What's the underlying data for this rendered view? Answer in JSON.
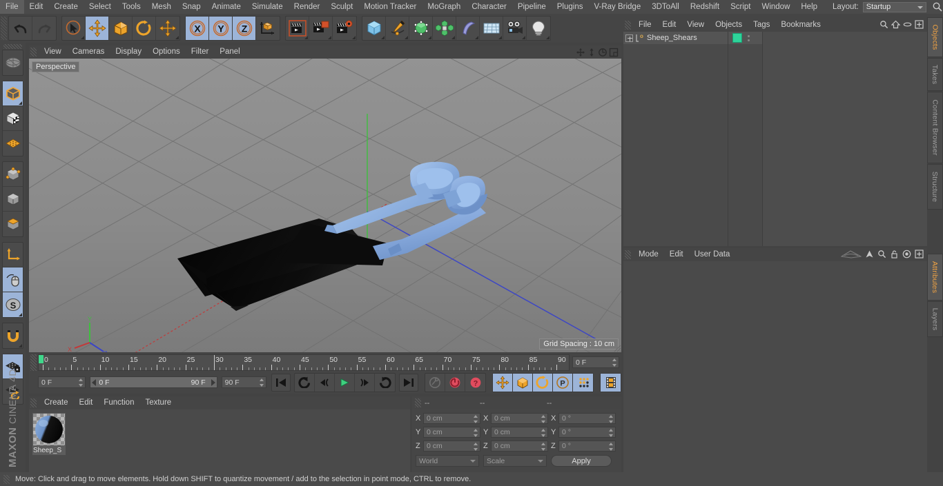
{
  "menubar": {
    "items": [
      "File",
      "Edit",
      "Create",
      "Select",
      "Tools",
      "Mesh",
      "Snap",
      "Animate",
      "Simulate",
      "Render",
      "Sculpt",
      "Motion Tracker",
      "MoGraph",
      "Character",
      "Pipeline",
      "Plugins",
      "V-Ray Bridge",
      "3DToAll",
      "Redshift",
      "Script",
      "Window",
      "Help"
    ],
    "layout_label": "Layout:",
    "layout_value": "Startup",
    "search_icon": "search-icon"
  },
  "toolbar": {
    "groups": [
      {
        "name": "history",
        "buttons": [
          {
            "name": "undo-button",
            "icon": "undo-arrow-icon",
            "active": false,
            "has_corner": false
          },
          {
            "name": "redo-button",
            "icon": "redo-arrow-icon",
            "active": false,
            "has_corner": false
          }
        ]
      },
      {
        "name": "transform-tools",
        "buttons": [
          {
            "name": "live-selection-tool",
            "icon": "cursor-circle-icon",
            "active": false,
            "has_corner": true
          },
          {
            "name": "move-tool",
            "icon": "move-arrows-icon",
            "active": true,
            "has_corner": false
          },
          {
            "name": "scale-tool",
            "icon": "scale-box-icon",
            "active": false,
            "has_corner": false
          },
          {
            "name": "rotate-tool",
            "icon": "rotate-arc-icon",
            "active": false,
            "has_corner": false
          },
          {
            "name": "transform-tool",
            "icon": "move-arrows-icon",
            "active": false,
            "has_corner": true
          }
        ]
      },
      {
        "name": "axis-locks",
        "buttons": [
          {
            "name": "x-axis-lock",
            "icon": "x-axis-icon",
            "active": true,
            "has_corner": false
          },
          {
            "name": "y-axis-lock",
            "icon": "y-axis-icon",
            "active": true,
            "has_corner": false
          },
          {
            "name": "z-axis-lock",
            "icon": "z-axis-icon",
            "active": true,
            "has_corner": false
          },
          {
            "name": "world-object-coordinate-toggle",
            "icon": "world-axis-cube-icon",
            "active": false,
            "has_corner": false
          }
        ]
      },
      {
        "name": "render-tools",
        "buttons": [
          {
            "name": "render-view-button",
            "icon": "clapperboard-region-icon",
            "active": false,
            "has_corner": true
          },
          {
            "name": "render-to-picture-viewer-button",
            "icon": "clapperboard-picture-icon",
            "active": false,
            "has_corner": true
          },
          {
            "name": "render-settings-button",
            "icon": "clapperboard-gear-icon",
            "active": false,
            "has_corner": true
          }
        ]
      },
      {
        "name": "create-objects",
        "buttons": [
          {
            "name": "add-primitive-cube-button",
            "icon": "blue-cube-icon",
            "active": false,
            "has_corner": true
          },
          {
            "name": "add-spline-button",
            "icon": "pen-spline-icon",
            "active": false,
            "has_corner": true
          },
          {
            "name": "add-nurbs-generator-button",
            "icon": "green-cube-points-icon",
            "active": false,
            "has_corner": true
          },
          {
            "name": "add-array-button",
            "icon": "green-cluster-icon",
            "active": false,
            "has_corner": true
          },
          {
            "name": "add-deformer-button",
            "icon": "bend-deformer-icon",
            "active": false,
            "has_corner": true
          },
          {
            "name": "add-scene-environment-button",
            "icon": "floor-grid-icon",
            "active": false,
            "has_corner": true
          },
          {
            "name": "add-camera-button",
            "icon": "camera-icon",
            "active": false,
            "has_corner": true
          },
          {
            "name": "add-light-button",
            "icon": "lightbulb-icon",
            "active": false,
            "has_corner": true
          }
        ]
      }
    ]
  },
  "left_toolbar": {
    "groups": [
      {
        "name": "view-group",
        "buttons": [
          {
            "name": "undo-view-button",
            "icon": "globe-wire-icon",
            "active": false,
            "has_corner": false
          }
        ]
      },
      {
        "name": "edit-mode-group",
        "buttons": [
          {
            "name": "make-editable-button",
            "icon": "orange-outline-cube-icon",
            "active": true,
            "has_corner": true
          },
          {
            "name": "enable-axis-modification-button",
            "icon": "checker-cube-icon",
            "active": false,
            "has_corner": false
          },
          {
            "name": "toggle-grid-button",
            "icon": "orange-grid-icon",
            "active": false,
            "has_corner": false
          }
        ]
      },
      {
        "name": "component-mode-group",
        "buttons": [
          {
            "name": "points-mode-button",
            "icon": "cube-points-icon",
            "active": false,
            "has_corner": false
          },
          {
            "name": "edges-mode-button",
            "icon": "cube-edges-icon",
            "active": false,
            "has_corner": false
          },
          {
            "name": "polygons-mode-button",
            "icon": "cube-polygons-icon",
            "active": false,
            "has_corner": false
          }
        ]
      },
      {
        "name": "axis-group",
        "buttons": [
          {
            "name": "object-axis-button",
            "icon": "axis-arrow-icon",
            "active": false,
            "has_corner": false
          },
          {
            "name": "texture-axis-button",
            "icon": "mouse-texture-icon",
            "active": true,
            "has_corner": false
          },
          {
            "name": "workplane-button",
            "icon": "s-disc-icon",
            "active": true,
            "has_corner": true
          }
        ]
      },
      {
        "name": "snap-group",
        "buttons": [
          {
            "name": "enable-snap-button",
            "icon": "magnet-icon",
            "active": false,
            "has_corner": true
          }
        ]
      },
      {
        "name": "workplane-group",
        "buttons": [
          {
            "name": "lock-workplane-button",
            "icon": "grid-lock-icon",
            "active": true,
            "has_corner": false
          },
          {
            "name": "planar-workplane-button",
            "icon": "grid-rotate-icon",
            "active": false,
            "has_corner": false
          }
        ]
      }
    ],
    "brand_primary": "MAXON",
    "brand_secondary": "CINEMA 4D"
  },
  "viewport": {
    "menu_items": [
      "View",
      "Cameras",
      "Display",
      "Options",
      "Filter",
      "Panel"
    ],
    "label": "Perspective",
    "grid_spacing": "Grid Spacing : 10 cm",
    "axis_labels": {
      "x": "X",
      "y": "Y",
      "z": "Z"
    },
    "colors": {
      "x_axis": "#c83232",
      "y_axis": "#3fbe3f",
      "z_axis": "#3c46c8",
      "background_top": "#8e8e8e",
      "background_bottom": "#7c7c7c",
      "model_handle": "#86a8db",
      "model_blade": "#0a0a0a"
    },
    "header_icons": [
      "pan-icon",
      "zoom-icon",
      "rotate-icon",
      "maximize-icon"
    ]
  },
  "timeline": {
    "ruler_ticks": [
      0,
      5,
      10,
      15,
      20,
      25,
      30,
      35,
      40,
      45,
      50,
      55,
      60,
      65,
      70,
      75,
      80,
      85,
      90
    ],
    "current_frame_marker": 0,
    "fields": {
      "current_frame": "0 F",
      "range_start": "0 F",
      "range_end": "90 F",
      "end_frame": "90 F",
      "preview_end": "0 F"
    },
    "transport": [
      {
        "name": "go-to-start-button",
        "icon": "skip-start-icon",
        "active": false
      },
      {
        "name": "previous-keyframe-button",
        "icon": "rewind-key-icon",
        "active": false
      },
      {
        "name": "step-back-button",
        "icon": "step-back-icon",
        "active": false
      },
      {
        "name": "play-button",
        "icon": "play-icon",
        "active": false
      },
      {
        "name": "step-forward-button",
        "icon": "step-forward-icon",
        "active": false
      },
      {
        "name": "next-keyframe-button",
        "icon": "forward-key-icon",
        "active": false
      },
      {
        "name": "go-to-end-button",
        "icon": "skip-end-icon",
        "active": false
      }
    ],
    "record": [
      {
        "name": "record-active-objects-button",
        "icon": "key-icon",
        "active": false
      },
      {
        "name": "autokeying-button",
        "icon": "red-circle-arrow-icon",
        "active": false
      },
      {
        "name": "keyframe-selection-button",
        "icon": "red-question-icon",
        "active": false
      }
    ],
    "key_filters": [
      {
        "name": "position-key-toggle",
        "icon": "move-arrows-icon",
        "active": true
      },
      {
        "name": "scale-key-toggle",
        "icon": "scale-box-icon",
        "active": true
      },
      {
        "name": "rotation-key-toggle",
        "icon": "rotate-arc-icon",
        "active": true
      },
      {
        "name": "parameter-key-toggle",
        "icon": "p-circle-icon",
        "active": true
      },
      {
        "name": "pla-key-toggle",
        "icon": "point-dots-icon",
        "active": true
      }
    ],
    "timeline_toggle": {
      "name": "animation-mode-button",
      "icon": "film-strip-icon",
      "active": true
    }
  },
  "material_manager": {
    "menu_items": [
      "Create",
      "Edit",
      "Function",
      "Texture"
    ],
    "materials": [
      {
        "name": "Sheep_S",
        "preview": "blue-black-sphere"
      }
    ]
  },
  "coordinates": {
    "header_dashes": [
      "--",
      "--",
      "--"
    ],
    "rows": [
      {
        "axis": "X",
        "position": "0 cm",
        "size": "0 cm",
        "rotation": "0 °"
      },
      {
        "axis": "Y",
        "position": "0 cm",
        "size": "0 cm",
        "rotation": "0 °"
      },
      {
        "axis": "Z",
        "position": "0 cm",
        "size": "0 cm",
        "rotation": "0 °"
      }
    ],
    "coordinate_system": "World",
    "transform_mode": "Scale",
    "apply_label": "Apply"
  },
  "object_manager": {
    "menu_items": [
      "File",
      "Edit",
      "View",
      "Objects",
      "Tags",
      "Bookmarks"
    ],
    "header_icons": [
      "search-icon",
      "home-icon",
      "eye-icon",
      "expand-icon"
    ],
    "objects": [
      {
        "name": "Sheep_Shears",
        "icon": "polygon-object-icon",
        "tag_color": "#2ed39a",
        "selected": true
      }
    ]
  },
  "attributes": {
    "menu_items": [
      "Mode",
      "Edit",
      "User Data"
    ],
    "header_icons": [
      "curve-icon",
      "arrow-up-icon",
      "search-icon",
      "lock-icon",
      "target-icon",
      "expand-icon"
    ]
  },
  "right_tabs": {
    "upper": [
      {
        "label": "Objects",
        "active": true
      },
      {
        "label": "Takes",
        "active": false
      },
      {
        "label": "Content Browser",
        "active": false
      },
      {
        "label": "Structure",
        "active": false
      }
    ],
    "lower": [
      {
        "label": "Attributes",
        "active": true
      },
      {
        "label": "Layers",
        "active": false
      }
    ]
  },
  "statusbar": {
    "message": "Move: Click and drag to move elements. Hold down SHIFT to quantize movement / add to the selection in point mode, CTRL to remove."
  }
}
